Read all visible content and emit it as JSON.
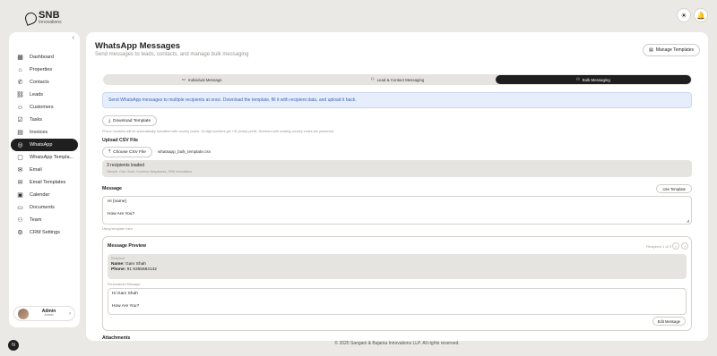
{
  "brand": {
    "name": "SNB",
    "tagline": "Innovations"
  },
  "header": {
    "theme_icon": "sun-icon",
    "notify_icon": "bell-icon"
  },
  "sidebar": {
    "collapse_glyph": "‹",
    "items": [
      {
        "label": "Dashboard",
        "icon": "grid-icon",
        "glyph": "▦",
        "active": false
      },
      {
        "label": "Properties",
        "icon": "home-icon",
        "glyph": "⌂",
        "active": false
      },
      {
        "label": "Contacts",
        "icon": "phone-icon",
        "glyph": "✆",
        "active": false
      },
      {
        "label": "Leads",
        "icon": "link-icon",
        "glyph": "⛓",
        "active": false
      },
      {
        "label": "Customers",
        "icon": "user-icon",
        "glyph": "☺",
        "active": false
      },
      {
        "label": "Tasks",
        "icon": "check-square-icon",
        "glyph": "☑",
        "active": false
      },
      {
        "label": "Invoices",
        "icon": "file-icon",
        "glyph": "▤",
        "active": false
      },
      {
        "label": "WhatsApp",
        "icon": "whatsapp-icon",
        "glyph": "◎",
        "active": true
      },
      {
        "label": "WhatsApp Templa...",
        "icon": "document-icon",
        "glyph": "▢",
        "active": false
      },
      {
        "label": "Email",
        "icon": "mail-icon",
        "glyph": "✉",
        "active": false
      },
      {
        "label": "Email Templates",
        "icon": "mail-template-icon",
        "glyph": "✉",
        "active": false
      },
      {
        "label": "Calendar",
        "icon": "calendar-icon",
        "glyph": "▣",
        "active": false
      },
      {
        "label": "Documents",
        "icon": "folder-icon",
        "glyph": "▭",
        "active": false
      },
      {
        "label": "Team",
        "icon": "team-icon",
        "glyph": "⚇",
        "active": false
      },
      {
        "label": "CRM Settings",
        "icon": "gear-icon",
        "glyph": "⚙",
        "active": false
      }
    ],
    "profile": {
      "name": "Admin",
      "role": "Admin"
    }
  },
  "main": {
    "title": "WhatsApp Messages",
    "subtitle": "Send messages to leads, contacts, and manage bulk messaging",
    "manage_templates": "Manage Templates",
    "tabs": [
      {
        "label": "Individual Message",
        "active": false
      },
      {
        "label": "Lead & Contact Messaging",
        "active": false
      },
      {
        "label": "Bulk Messaging",
        "active": true
      }
    ],
    "info": "Send WhatsApp messages to multiple recipients at once. Download the template, fill it with recipient data, and upload it back.",
    "download_template": "Download Template",
    "phone_hint": "Phone numbers will be automatically formatted with country codes. 10-digit numbers get +91 (India) prefix. Numbers with existing country codes are preserved.",
    "upload_label": "Upload CSV File",
    "choose_csv": "Choose CSV File",
    "file_name": "whatsapp_bulk_template.csv",
    "loaded_title": "3 recipients loaded",
    "loaded_sub": "Sample: Garv Shah, Krushna Variyakanta, SNB Innovations",
    "message_label": "Message",
    "use_template": "Use Template",
    "message_lines": [
      "Hi {name}",
      "",
      "How Are You?"
    ],
    "using_template": "Using template: intro",
    "preview": {
      "title": "Message Preview",
      "count": "Recipient 1 of 3",
      "recipient_caption": "Recipient",
      "name_label": "Name:",
      "name_value": "Garv Shah",
      "phone_label": "Phone:",
      "phone_value": "91 6355664142",
      "personalized_caption": "Personalized Message",
      "personalized_lines": [
        "Hi Garv Shah",
        "",
        "How Are You?"
      ],
      "edit_button": "Edit Message"
    },
    "attachments_label": "Attachments"
  },
  "footer": "© 2025 Sangani & Bajania Innovations LLP. All rights reserved."
}
